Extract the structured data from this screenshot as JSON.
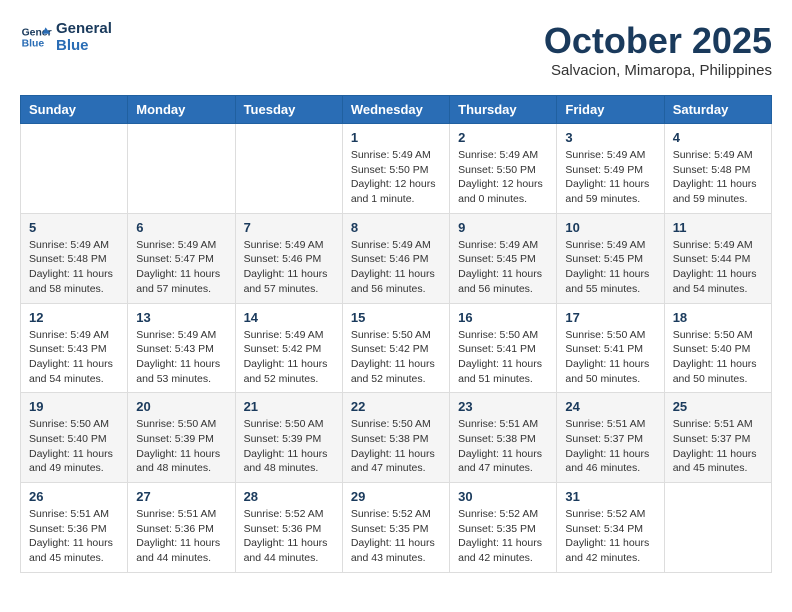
{
  "logo": {
    "line1": "General",
    "line2": "Blue"
  },
  "title": "October 2025",
  "subtitle": "Salvacion, Mimaropa, Philippines",
  "days_header": [
    "Sunday",
    "Monday",
    "Tuesday",
    "Wednesday",
    "Thursday",
    "Friday",
    "Saturday"
  ],
  "weeks": [
    [
      {
        "day": "",
        "detail": ""
      },
      {
        "day": "",
        "detail": ""
      },
      {
        "day": "",
        "detail": ""
      },
      {
        "day": "1",
        "detail": "Sunrise: 5:49 AM\nSunset: 5:50 PM\nDaylight: 12 hours\nand 1 minute."
      },
      {
        "day": "2",
        "detail": "Sunrise: 5:49 AM\nSunset: 5:50 PM\nDaylight: 12 hours\nand 0 minutes."
      },
      {
        "day": "3",
        "detail": "Sunrise: 5:49 AM\nSunset: 5:49 PM\nDaylight: 11 hours\nand 59 minutes."
      },
      {
        "day": "4",
        "detail": "Sunrise: 5:49 AM\nSunset: 5:48 PM\nDaylight: 11 hours\nand 59 minutes."
      }
    ],
    [
      {
        "day": "5",
        "detail": "Sunrise: 5:49 AM\nSunset: 5:48 PM\nDaylight: 11 hours\nand 58 minutes."
      },
      {
        "day": "6",
        "detail": "Sunrise: 5:49 AM\nSunset: 5:47 PM\nDaylight: 11 hours\nand 57 minutes."
      },
      {
        "day": "7",
        "detail": "Sunrise: 5:49 AM\nSunset: 5:46 PM\nDaylight: 11 hours\nand 57 minutes."
      },
      {
        "day": "8",
        "detail": "Sunrise: 5:49 AM\nSunset: 5:46 PM\nDaylight: 11 hours\nand 56 minutes."
      },
      {
        "day": "9",
        "detail": "Sunrise: 5:49 AM\nSunset: 5:45 PM\nDaylight: 11 hours\nand 56 minutes."
      },
      {
        "day": "10",
        "detail": "Sunrise: 5:49 AM\nSunset: 5:45 PM\nDaylight: 11 hours\nand 55 minutes."
      },
      {
        "day": "11",
        "detail": "Sunrise: 5:49 AM\nSunset: 5:44 PM\nDaylight: 11 hours\nand 54 minutes."
      }
    ],
    [
      {
        "day": "12",
        "detail": "Sunrise: 5:49 AM\nSunset: 5:43 PM\nDaylight: 11 hours\nand 54 minutes."
      },
      {
        "day": "13",
        "detail": "Sunrise: 5:49 AM\nSunset: 5:43 PM\nDaylight: 11 hours\nand 53 minutes."
      },
      {
        "day": "14",
        "detail": "Sunrise: 5:49 AM\nSunset: 5:42 PM\nDaylight: 11 hours\nand 52 minutes."
      },
      {
        "day": "15",
        "detail": "Sunrise: 5:50 AM\nSunset: 5:42 PM\nDaylight: 11 hours\nand 52 minutes."
      },
      {
        "day": "16",
        "detail": "Sunrise: 5:50 AM\nSunset: 5:41 PM\nDaylight: 11 hours\nand 51 minutes."
      },
      {
        "day": "17",
        "detail": "Sunrise: 5:50 AM\nSunset: 5:41 PM\nDaylight: 11 hours\nand 50 minutes."
      },
      {
        "day": "18",
        "detail": "Sunrise: 5:50 AM\nSunset: 5:40 PM\nDaylight: 11 hours\nand 50 minutes."
      }
    ],
    [
      {
        "day": "19",
        "detail": "Sunrise: 5:50 AM\nSunset: 5:40 PM\nDaylight: 11 hours\nand 49 minutes."
      },
      {
        "day": "20",
        "detail": "Sunrise: 5:50 AM\nSunset: 5:39 PM\nDaylight: 11 hours\nand 48 minutes."
      },
      {
        "day": "21",
        "detail": "Sunrise: 5:50 AM\nSunset: 5:39 PM\nDaylight: 11 hours\nand 48 minutes."
      },
      {
        "day": "22",
        "detail": "Sunrise: 5:50 AM\nSunset: 5:38 PM\nDaylight: 11 hours\nand 47 minutes."
      },
      {
        "day": "23",
        "detail": "Sunrise: 5:51 AM\nSunset: 5:38 PM\nDaylight: 11 hours\nand 47 minutes."
      },
      {
        "day": "24",
        "detail": "Sunrise: 5:51 AM\nSunset: 5:37 PM\nDaylight: 11 hours\nand 46 minutes."
      },
      {
        "day": "25",
        "detail": "Sunrise: 5:51 AM\nSunset: 5:37 PM\nDaylight: 11 hours\nand 45 minutes."
      }
    ],
    [
      {
        "day": "26",
        "detail": "Sunrise: 5:51 AM\nSunset: 5:36 PM\nDaylight: 11 hours\nand 45 minutes."
      },
      {
        "day": "27",
        "detail": "Sunrise: 5:51 AM\nSunset: 5:36 PM\nDaylight: 11 hours\nand 44 minutes."
      },
      {
        "day": "28",
        "detail": "Sunrise: 5:52 AM\nSunset: 5:36 PM\nDaylight: 11 hours\nand 44 minutes."
      },
      {
        "day": "29",
        "detail": "Sunrise: 5:52 AM\nSunset: 5:35 PM\nDaylight: 11 hours\nand 43 minutes."
      },
      {
        "day": "30",
        "detail": "Sunrise: 5:52 AM\nSunset: 5:35 PM\nDaylight: 11 hours\nand 42 minutes."
      },
      {
        "day": "31",
        "detail": "Sunrise: 5:52 AM\nSunset: 5:34 PM\nDaylight: 11 hours\nand 42 minutes."
      },
      {
        "day": "",
        "detail": ""
      }
    ]
  ]
}
